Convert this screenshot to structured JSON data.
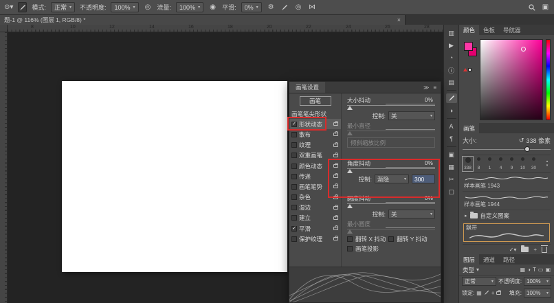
{
  "icons": {
    "chevron": "▾",
    "chevron_right": "▸",
    "check": "✓",
    "close": "×",
    "menu": "≡",
    "double_arrow": "≫",
    "reset": "↺",
    "gear": "⚙",
    "play": "▶",
    "history": "◔",
    "info": "ⓘ",
    "panel_list": "▤",
    "panel_grid": "▦",
    "panel_square": "▣",
    "panel_columns": "▥",
    "adjust": "◑",
    "char_a": "A",
    "paragraph": "¶",
    "scissors": "✂",
    "symmetry": "⋈",
    "airbrush": "◉",
    "pressure": "◎",
    "target": "⊙",
    "spin_up": "▴",
    "spin_down": "▾",
    "type_t": "T",
    "shape": "▭",
    "plus": "+",
    "box": "▢"
  },
  "options_bar": {
    "mode_label": "模式:",
    "mode_value": "正常",
    "opacity_label": "不透明度:",
    "opacity_value": "100%",
    "flow_label": "流量:",
    "flow_value": "100%",
    "smooth_label": "平滑:",
    "smooth_value": "0%"
  },
  "document_tab": {
    "title": "题-1 @ 116% (图层 1, RGB/8) *"
  },
  "ruler": {
    "h": [
      "8",
      "10",
      "12",
      "14",
      "16",
      "18",
      "20",
      "22",
      "24",
      "26",
      "28"
    ]
  },
  "brush_settings": {
    "panel_title": "画笔设置",
    "brushes_button": "画笔",
    "items": [
      {
        "label": "画笔笔尖形状",
        "check": ""
      },
      {
        "label": "形状动态",
        "check": "✓"
      },
      {
        "label": "散布",
        "check": ""
      },
      {
        "label": "纹理",
        "check": ""
      },
      {
        "label": "双重画笔",
        "check": ""
      },
      {
        "label": "颜色动态",
        "check": ""
      },
      {
        "label": "传递",
        "check": ""
      },
      {
        "label": "画笔笔势",
        "check": ""
      },
      {
        "label": "杂色",
        "check": ""
      },
      {
        "label": "湿边",
        "check": ""
      },
      {
        "label": "建立",
        "check": ""
      },
      {
        "label": "平滑",
        "check": "✓"
      },
      {
        "label": "保护纹理",
        "check": ""
      }
    ],
    "size_jitter_label": "大小抖动",
    "size_jitter_value": "0%",
    "control_label": "控制:",
    "size_control_value": "关",
    "min_diameter_label": "最小直径",
    "tilt_scale_label": "倾斜缩放比例",
    "angle_jitter_label": "角度抖动",
    "angle_jitter_value": "0%",
    "angle_control_value": "渐隐",
    "angle_fade_value": "300",
    "roundness_jitter_label": "圆度抖动",
    "roundness_jitter_value": "0%",
    "roundness_control_value": "关",
    "min_roundness_label": "最小圆度",
    "flip_x_label": "翻转 X 抖动",
    "flip_y_label": "翻转 Y 抖动",
    "projection_label": "画笔投影"
  },
  "color_panel": {
    "tabs": [
      "颜色",
      "色板",
      "导航器"
    ],
    "foreground_color": "#ff37a6",
    "background_color": "#e2006f",
    "picker_hue": "#ff0098"
  },
  "brushes_panel": {
    "tab": "画笔",
    "size_label": "大小:",
    "size_value": "338 像素",
    "presets": [
      "338",
      "8",
      "1",
      "4",
      "9",
      "10",
      "30"
    ],
    "items": [
      {
        "label": "样本画笔 1943"
      },
      {
        "label": "样本画笔 1944"
      }
    ],
    "folder_label": "自定义图案",
    "selected_brush_label": "飘带"
  },
  "layers_panel": {
    "tabs": [
      "图层",
      "通道",
      "路径"
    ],
    "filter_label": "类型",
    "blend_mode": "正常",
    "opacity_label": "不透明度:",
    "opacity_value": "100%",
    "lock_label": "锁定:",
    "fill_label": "填充:",
    "fill_value": "100%"
  }
}
